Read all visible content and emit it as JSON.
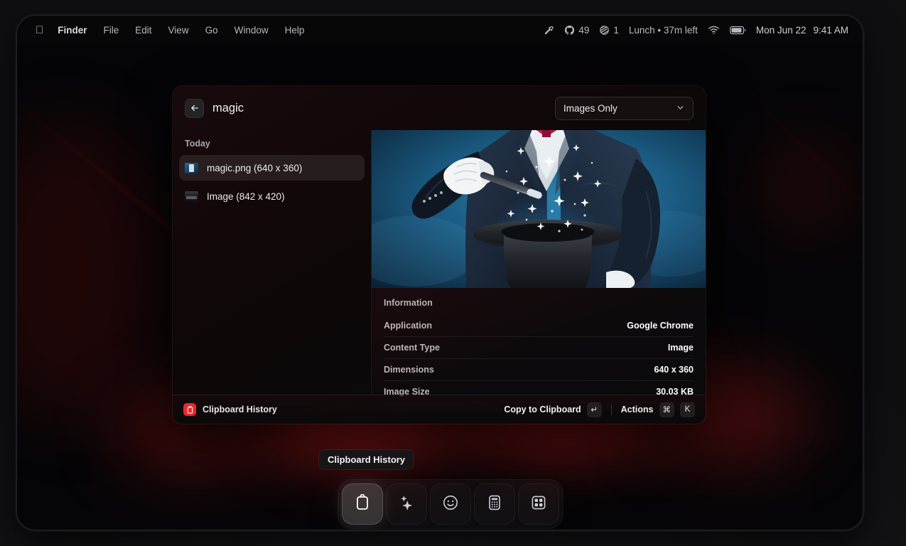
{
  "menubar": {
    "apple_icon": "apple-icon",
    "items": [
      {
        "label": "Finder",
        "bold": true
      },
      {
        "label": "File",
        "bold": false
      },
      {
        "label": "Edit",
        "bold": false
      },
      {
        "label": "View",
        "bold": false
      },
      {
        "label": "Go",
        "bold": false
      },
      {
        "label": "Window",
        "bold": false
      },
      {
        "label": "Help",
        "bold": false
      }
    ],
    "tray": {
      "eyedropper_icon": "eyedropper-icon",
      "github_icon": "github-icon",
      "github_count": "49",
      "stack_icon": "stacked-circle-icon",
      "stack_count": "1",
      "focus_status": "Lunch • 37m left",
      "wifi_icon": "wifi-icon",
      "battery_icon": "battery-icon",
      "date": "Mon Jun 22",
      "time": "9:41 AM"
    }
  },
  "panel": {
    "back_icon": "arrow-left-icon",
    "title": "magic",
    "filter": {
      "value": "Images Only",
      "chevron_icon": "chevron-down-icon",
      "options": [
        "Images Only"
      ]
    },
    "sidebar": {
      "section_title": "Today",
      "items": [
        {
          "label": "magic.png (640 x 360)",
          "thumb": "image-thumb-magic",
          "selected": true
        },
        {
          "label": "Image (842 x 420)",
          "thumb": "image-thumb-generic",
          "selected": false
        }
      ]
    },
    "preview": {
      "image_alt": "magician-with-wand-and-top-hat",
      "info_title": "Information",
      "rows": [
        {
          "key": "Application",
          "value": "Google Chrome"
        },
        {
          "key": "Content Type",
          "value": "Image"
        },
        {
          "key": "Dimensions",
          "value": "640 x 360"
        },
        {
          "key": "Image Size",
          "value": "30.03 KB"
        }
      ]
    },
    "footer": {
      "brand_icon": "clipboard-icon",
      "brand": "Clipboard History",
      "primary_action": "Copy to Clipboard",
      "primary_key": "↵",
      "secondary_action": "Actions",
      "secondary_key_1": "⌘",
      "secondary_key_2": "K"
    }
  },
  "tooltip": {
    "text": "Clipboard History"
  },
  "dock": {
    "items": [
      {
        "name": "clipboard-icon",
        "label": "Clipboard History",
        "active": true
      },
      {
        "name": "sparkles-icon",
        "label": "AI",
        "active": false
      },
      {
        "name": "smiley-icon",
        "label": "Emoji",
        "active": false
      },
      {
        "name": "calculator-icon",
        "label": "Calculator",
        "active": false
      },
      {
        "name": "grid-icon",
        "label": "Apps",
        "active": false
      }
    ]
  },
  "colors": {
    "accent_red": "#e8282f",
    "panel_tint": "#1b0a0d",
    "wallpaper": "#050507"
  }
}
